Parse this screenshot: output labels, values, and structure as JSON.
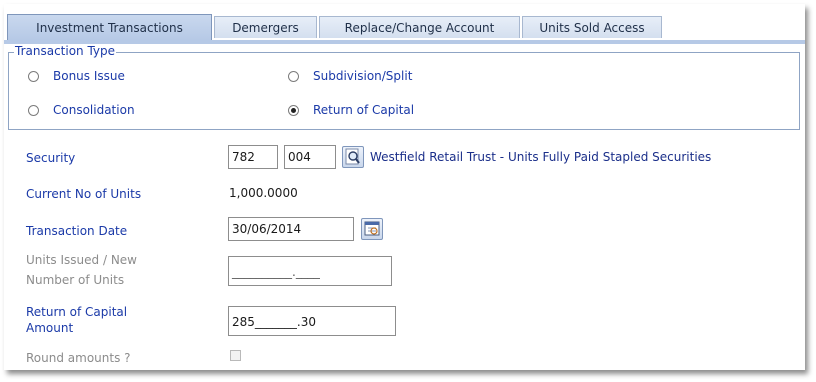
{
  "tabs": [
    {
      "label": "Investment Transactions",
      "active": true
    },
    {
      "label": "Demergers",
      "active": false
    },
    {
      "label": "Replace/Change Account",
      "active": false
    },
    {
      "label": "Units Sold Access",
      "active": false
    }
  ],
  "transaction_type": {
    "legend": "Transaction Type",
    "options": [
      {
        "label": "Bonus Issue",
        "checked": false
      },
      {
        "label": "Subdivision/Split",
        "checked": false
      },
      {
        "label": "Consolidation",
        "checked": false
      },
      {
        "label": "Return of Capital",
        "checked": true
      }
    ]
  },
  "security": {
    "label": "Security",
    "code1": "782",
    "code2": "004",
    "description": "Westfield Retail Trust - Units Fully Paid Stapled Securities",
    "lookup_icon": "magnifier-icon"
  },
  "current_units": {
    "label": "Current No of Units",
    "value": "1,000.0000"
  },
  "transaction_date": {
    "label": "Transaction Date",
    "value": "30/06/2014",
    "calendar_icon": "calendar-icon"
  },
  "units_issued": {
    "label_line1": "Units Issued / New",
    "label_line2": "Number of Units",
    "value": "__________.____"
  },
  "return_capital": {
    "label_line1": "Return of Capital",
    "label_line2": "Amount",
    "value": "285_______.30"
  },
  "round_amounts": {
    "label": "Round amounts ?",
    "checked": false
  }
}
